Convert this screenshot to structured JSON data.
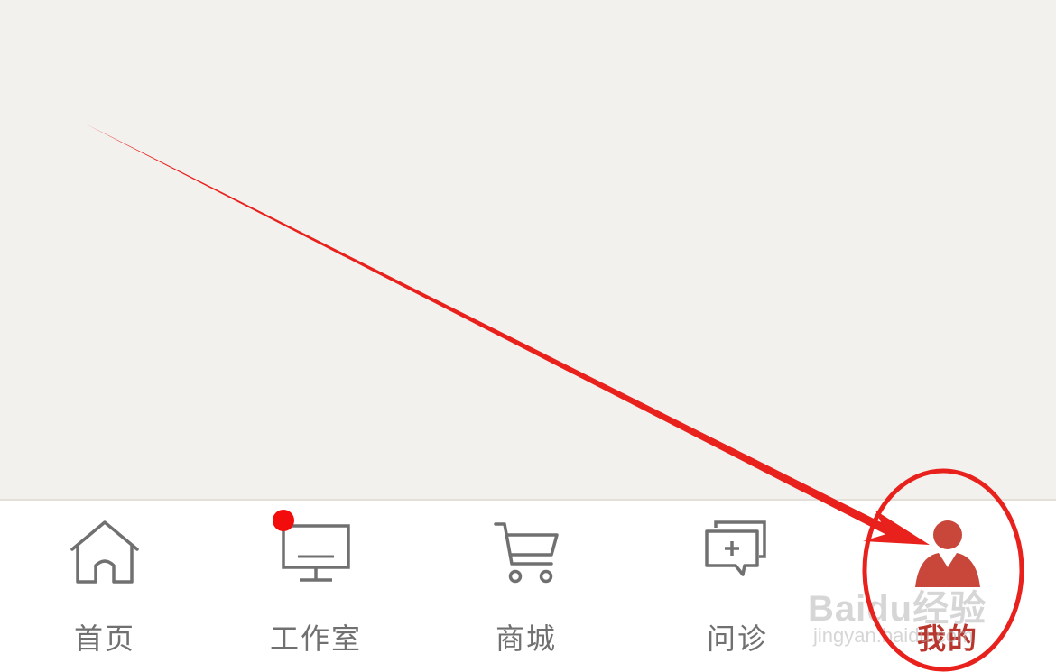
{
  "tabs": [
    {
      "label": "首页",
      "icon": "home-icon",
      "active": false
    },
    {
      "label": "工作室",
      "icon": "monitor-icon",
      "active": false,
      "badge": true
    },
    {
      "label": "商城",
      "icon": "cart-icon",
      "active": false
    },
    {
      "label": "问诊",
      "icon": "chat-plus-icon",
      "active": false
    },
    {
      "label": "我的",
      "icon": "user-icon",
      "active": true
    }
  ],
  "colors": {
    "background": "#f3f1ed",
    "tabbar": "#ffffff",
    "inactive": "#707070",
    "active": "#b8362d",
    "badge": "#f20c0c",
    "annotation": "#e8211c"
  },
  "watermark": {
    "main": "Baidu经验",
    "sub": "jingyan.baidu.com"
  }
}
